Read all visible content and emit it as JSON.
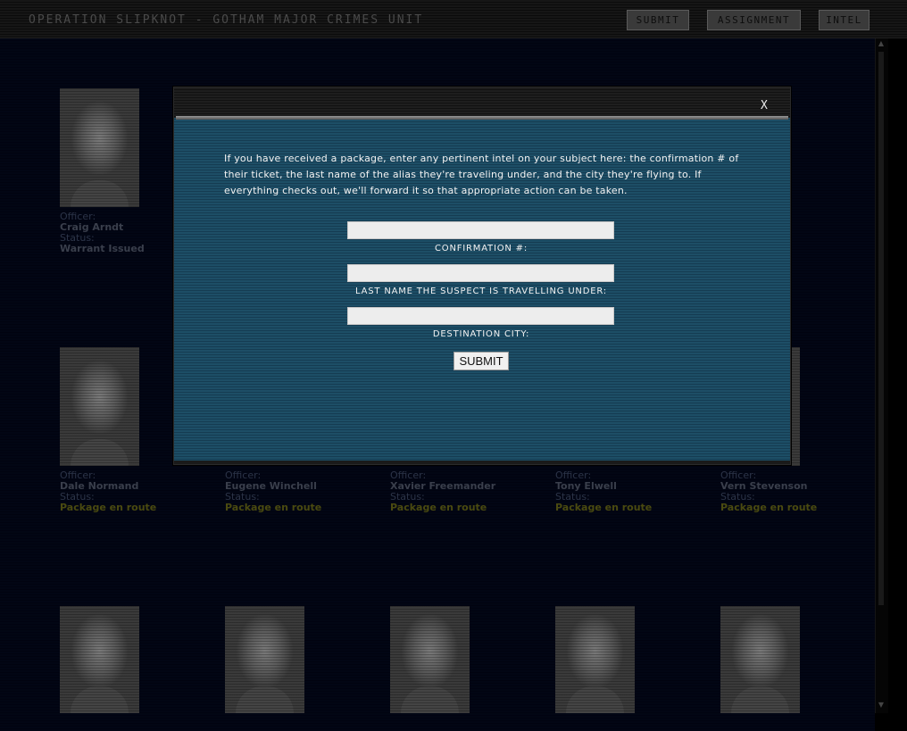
{
  "app": {
    "title": "OPERATION SLIPKNOT - GOTHAM MAJOR CRIMES UNIT"
  },
  "nav": {
    "submit": "SUBMIT",
    "assignment": "ASSIGNMENT",
    "intel": "INTEL"
  },
  "officer_label": "Officer:",
  "status_label": "Status:",
  "officers": [
    {
      "name": "Craig Arndt",
      "status": "Warrant Issued"
    },
    {
      "name": "Dale Normand",
      "status": "Package en route"
    },
    {
      "name": "Eugene Winchell",
      "status": "Package en route"
    },
    {
      "name": "Xavier Freemander",
      "status": "Package en route"
    },
    {
      "name": "Tony Elwell",
      "status": "Package en route"
    },
    {
      "name": "Vern Stevenson",
      "status": "Package en route"
    }
  ],
  "modal": {
    "close": "X",
    "intro": "If you have received a package, enter any pertinent intel on your subject here: the confirmation # of their ticket, the last name of the alias they're traveling under, and the city they're flying to. If everything checks out, we'll forward it so that appropriate action can be taken.",
    "fields": {
      "confirmation": {
        "label": "CONFIRMATION #:",
        "value": ""
      },
      "last_name": {
        "label": "LAST NAME THE SUSPECT IS TRAVELLING UNDER:",
        "value": ""
      },
      "destination": {
        "label": "DESTINATION CITY:",
        "value": ""
      }
    },
    "submit": "SUBMIT"
  },
  "colors": {
    "modal_bg": "#1d4e66",
    "page_bg": "#020614",
    "status_package": "#4a4a10"
  }
}
